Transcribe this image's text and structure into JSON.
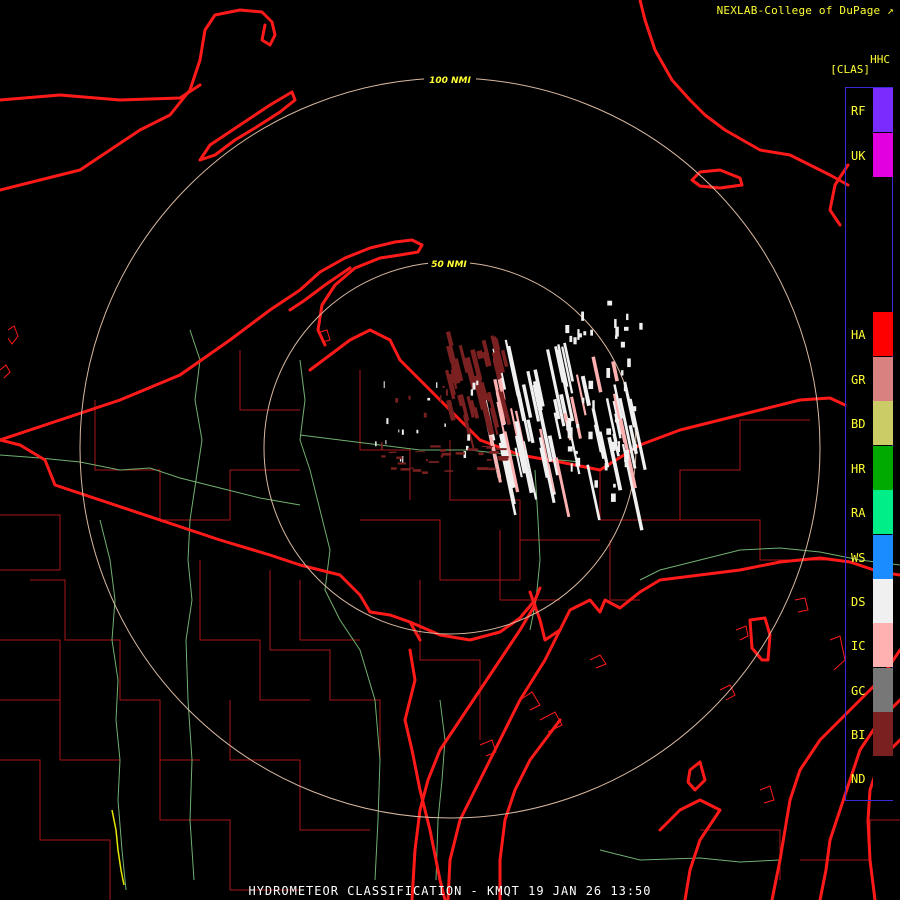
{
  "credit": "NEXLAB-College of DuPage",
  "product_code": "HHC",
  "classification_tag": "[CLAS]",
  "range_rings": [
    "100 NMI",
    "50 NMI"
  ],
  "footer": "HYDROMETEOR CLASSIFICATION - KMQT 19 JAN 26 13:50",
  "legend": [
    {
      "code": "RF",
      "color": "#7a2cff"
    },
    {
      "code": "UK",
      "color": "#e000e0"
    },
    {
      "code": "HA",
      "color": "#ff0000"
    },
    {
      "code": "GR",
      "color": "#d98080"
    },
    {
      "code": "BD",
      "color": "#cccc66"
    },
    {
      "code": "HR",
      "color": "#00aa00"
    },
    {
      "code": "RA",
      "color": "#00ee88"
    },
    {
      "code": "WS",
      "color": "#1a8cff"
    },
    {
      "code": "DS",
      "color": "#f0f0f0"
    },
    {
      "code": "IC",
      "color": "#ffb0b0"
    },
    {
      "code": "GC",
      "color": "#777777"
    },
    {
      "code": "BI",
      "color": "#7a2020"
    },
    {
      "code": "ND",
      "color": "#000000"
    }
  ],
  "colors": {
    "state_lines": "#ff1a1a",
    "county_lines": "#b01818",
    "rivers": "#70b070",
    "range_rings": "#d8b8a0"
  }
}
